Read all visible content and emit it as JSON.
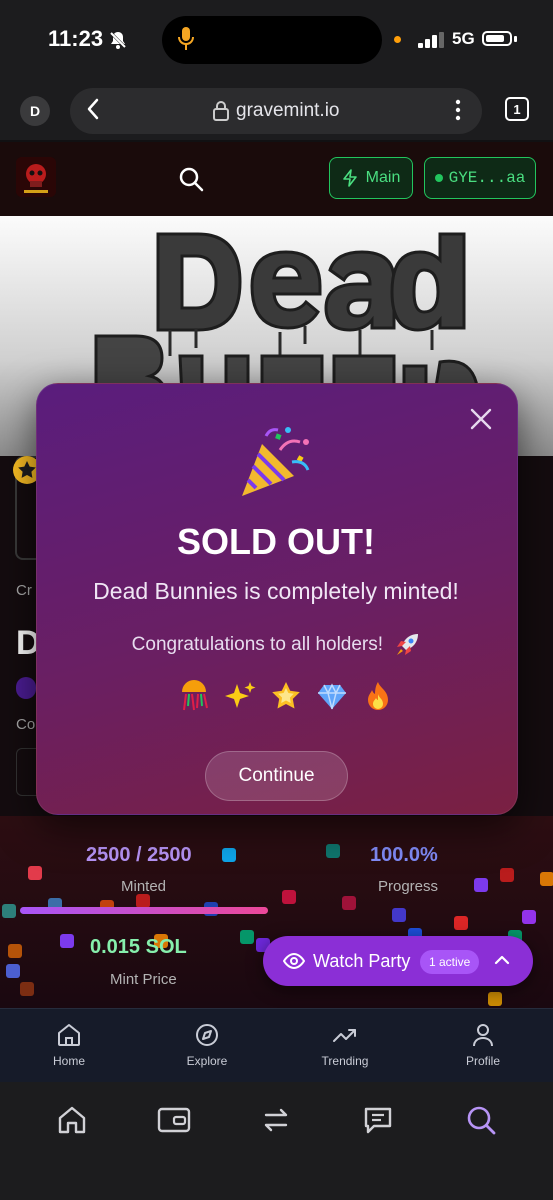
{
  "status_bar": {
    "time": "11:23",
    "network": "5G"
  },
  "browser": {
    "profile_initial": "D",
    "url": "gravemint.io",
    "tab_count": "1"
  },
  "site_header": {
    "main_button": "Main",
    "wallet_button": "GYE...aa"
  },
  "page_peek": {
    "creator_fragment": "Cr",
    "name_fragment": "D",
    "collection_fragment": "Co"
  },
  "stats": {
    "minted_value": "2500 / 2500",
    "minted_label": "Minted",
    "progress_value": "100.0%",
    "progress_label": "Progress",
    "progress_fraction": 1.0,
    "price_value": "0.015 SOL",
    "price_label": "Mint Price"
  },
  "watch_party": {
    "label": "Watch Party",
    "badge": "1 active"
  },
  "site_nav": {
    "items": [
      {
        "label": "Home",
        "icon": "home-icon"
      },
      {
        "label": "Explore",
        "icon": "compass-icon"
      },
      {
        "label": "Trending",
        "icon": "trending-icon"
      },
      {
        "label": "Profile",
        "icon": "user-icon"
      }
    ]
  },
  "modal": {
    "title": "SOLD OUT!",
    "subtitle": "Dead Bunnies is completely minted!",
    "congrats": "Congratulations to all holders!",
    "emojis": [
      "confetti-ball",
      "sparkles",
      "glowing-star",
      "gem",
      "fire"
    ],
    "continue_label": "Continue"
  },
  "colors": {
    "accent_green": "#22c55e",
    "accent_purple": "#a855f7",
    "modal_start": "#5a1d7d",
    "modal_end": "#7a2042"
  }
}
